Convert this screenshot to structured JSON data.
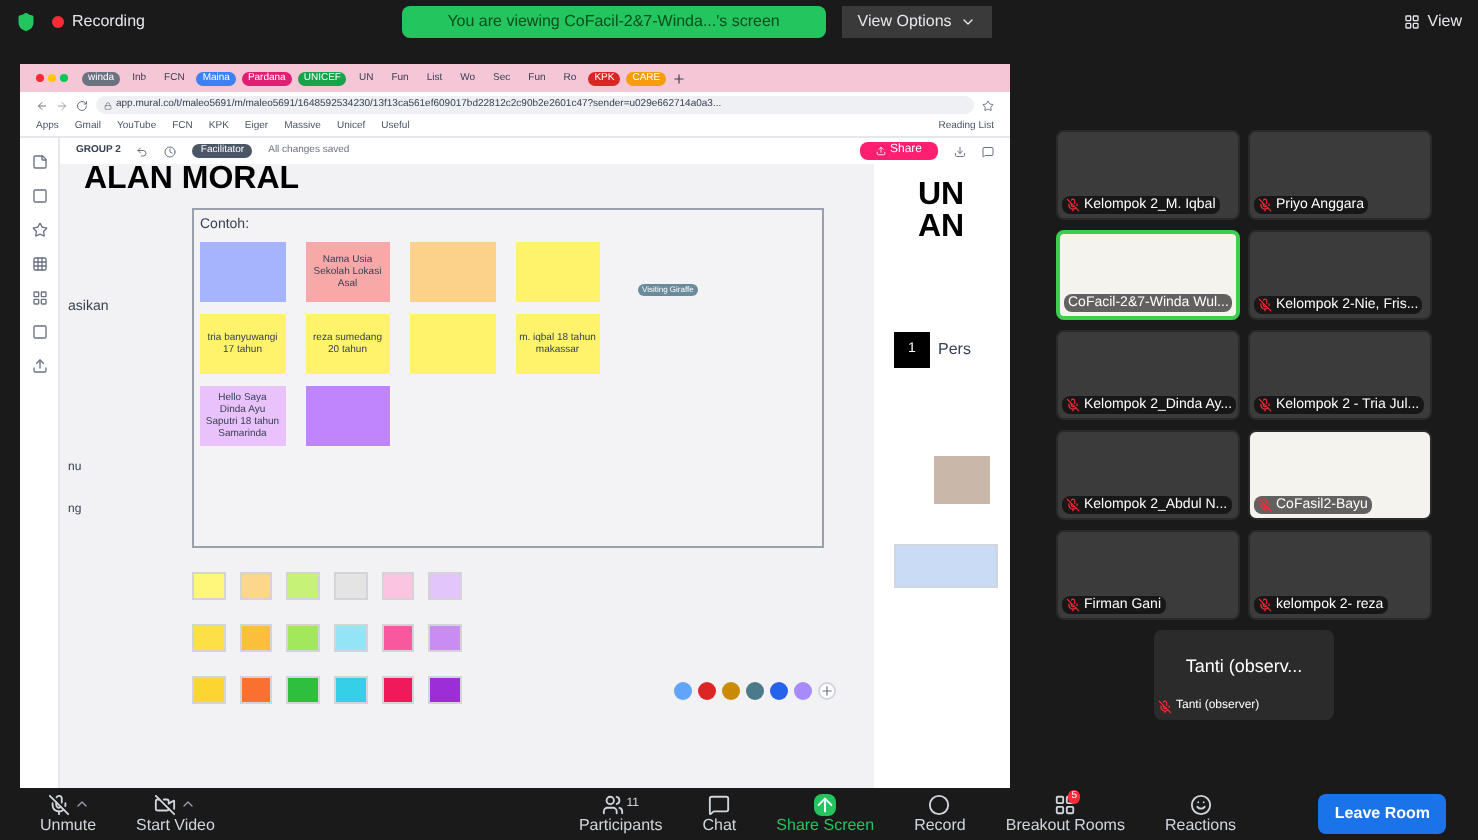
{
  "top_bar": {
    "recording": "Recording",
    "banner": "You are viewing CoFacil-2&7-Winda...'s screen",
    "view_options": "View Options",
    "view": "View"
  },
  "browser": {
    "tabs": [
      {
        "label": "winda",
        "color": "#6b7280"
      },
      {
        "label": "Inb"
      },
      {
        "label": "FCN"
      },
      {
        "label": "Maina",
        "color": "#3b82f6"
      },
      {
        "label": "Pardana",
        "color": "#e11d74"
      },
      {
        "label": "UNICEF",
        "color": "#16a34a"
      },
      {
        "label": "UN"
      },
      {
        "label": "Fun"
      },
      {
        "label": "List"
      },
      {
        "label": "Wo"
      },
      {
        "label": "Sec"
      },
      {
        "label": "Fun"
      },
      {
        "label": "Ro"
      },
      {
        "label": "KPK",
        "color": "#dc2626"
      },
      {
        "label": "CARE",
        "color": "#f59e0b"
      }
    ],
    "address": "app.mural.co/t/maleo5691/m/maleo5691/1648592534230/13f13ca561ef609017bd22812c2c90b2e2601c47?sender=u029e662714a0a3...",
    "bookmarks": [
      "Apps",
      "Gmail",
      "YouTube",
      "FCN",
      "KPK",
      "Eiger",
      "Massive",
      "Unicef",
      "Useful"
    ],
    "reading_list": "Reading List"
  },
  "mural": {
    "group": "GROUP 2",
    "role": "Facilitator",
    "saved": "All changes saved",
    "share": "Share",
    "heading": "ALAN MORAL",
    "frame_title": "Contoh:",
    "side_text": "asikan",
    "side_texts": [
      "nu",
      "ng"
    ],
    "cursor_label": "Visiting Giraffe",
    "notes": [
      {
        "color": "#a5b4fc"
      },
      {
        "text": "Nama Usia Sekolah Lokasi Asal",
        "color": "#f9a8a8"
      },
      {
        "color": "#fcd28a"
      },
      {
        "color": "#fef36b"
      },
      {
        "text": "tria banyuwangi 17 tahun",
        "color": "#fef36b"
      },
      {
        "text": "reza sumedang 20 tahun",
        "color": "#fef36b"
      },
      {
        "color": "#fef36b"
      },
      {
        "text": "m. iqbal 18 tahun makassar",
        "color": "#fef36b"
      },
      {
        "text": "Hello Saya Dinda Ayu Saputri 18 tahun Samarinda",
        "color": "#e9c2fb"
      },
      {
        "color": "#c084fc"
      }
    ],
    "palette": [
      [
        {
          "color": "#fef77c"
        },
        {
          "color": "#fcd68a"
        },
        {
          "color": "#c5f277"
        },
        {
          "color": "#e4e4e4"
        },
        {
          "color": "#fbc4e0"
        },
        {
          "color": "#e2c5fb"
        }
      ],
      [
        {
          "color": "#fde047"
        },
        {
          "color": "#fbbf3c"
        },
        {
          "color": "#a3e85c"
        },
        {
          "color": "#93e4f5"
        },
        {
          "color": "#f7589e"
        },
        {
          "color": "#c98cf3"
        }
      ],
      [
        {
          "color": "#fcd531"
        },
        {
          "color": "#f97030"
        },
        {
          "color": "#2fbf3f"
        },
        {
          "color": "#35d0e8"
        },
        {
          "color": "#f01a5a"
        },
        {
          "color": "#9b2ed6"
        }
      ]
    ],
    "right_panel": {
      "title_lines": [
        "UN",
        "AN"
      ],
      "number": "1",
      "item": "Pers"
    },
    "avatars": [
      {
        "color": "#60a5fa"
      },
      {
        "color": "#dc2626"
      },
      {
        "color": "#ca8a04"
      },
      {
        "color": "#4b7a8a"
      },
      {
        "color": "#2563eb"
      },
      {
        "color": "#a78bfa"
      }
    ]
  },
  "gallery": [
    {
      "name": "Kelompok 2_M. Iqbal",
      "muted": true,
      "speaking": false,
      "kind": "video"
    },
    {
      "name": "Priyo Anggara",
      "muted": true,
      "speaking": false,
      "kind": "video"
    },
    {
      "name": "CoFacil-2&7-Winda Wul...",
      "muted": false,
      "speaking": true,
      "kind": "slide"
    },
    {
      "name": "Kelompok 2-Nie, Fris...",
      "muted": true,
      "speaking": false,
      "kind": "video"
    },
    {
      "name": "Kelompok 2_Dinda Ay...",
      "muted": true,
      "speaking": false,
      "kind": "video"
    },
    {
      "name": "Kelompok 2 - Tria Jul...",
      "muted": true,
      "speaking": false,
      "kind": "video"
    },
    {
      "name": "Kelompok 2_Abdul N...",
      "muted": true,
      "speaking": false,
      "kind": "video"
    },
    {
      "name": "CoFasil2-Bayu",
      "muted": true,
      "speaking": false,
      "kind": "slide"
    },
    {
      "name": "Firman Gani",
      "muted": true,
      "speaking": false,
      "kind": "video"
    },
    {
      "name": "kelompok 2- reza",
      "muted": true,
      "speaking": false,
      "kind": "video"
    }
  ],
  "observer": {
    "display": "Tanti (observ...",
    "name": "Tanti (observer)",
    "muted": true
  },
  "toolbar": {
    "unmute": "Unmute",
    "video": "Start Video",
    "participants": "Participants",
    "count": "11",
    "chat": "Chat",
    "share": "Share Screen",
    "record": "Record",
    "breakout": "Breakout Rooms",
    "breakout_badge": "5",
    "reactions": "Reactions",
    "leave": "Leave Room"
  }
}
